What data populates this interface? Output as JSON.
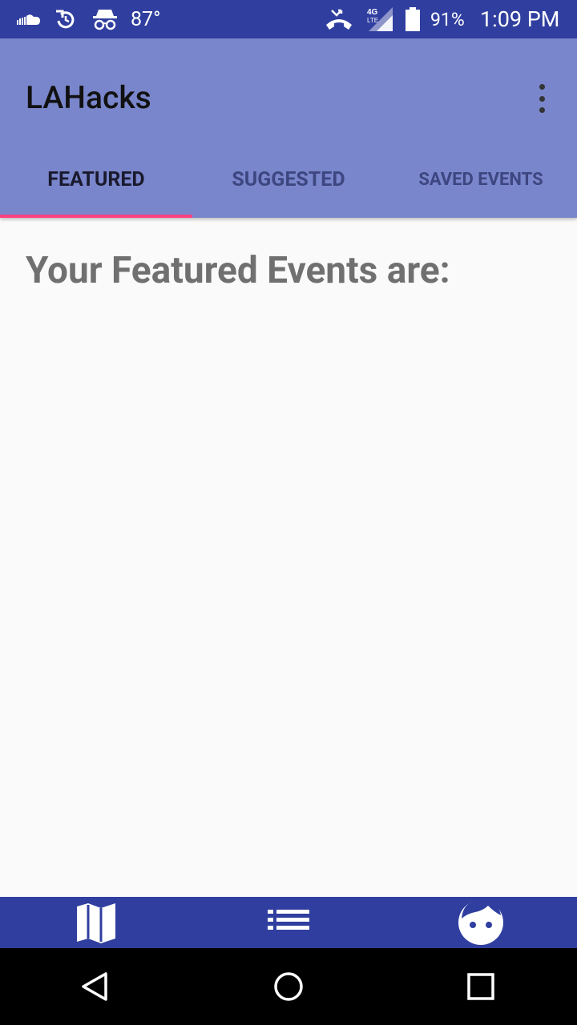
{
  "status_bar": {
    "temperature": "87°",
    "battery": "91%",
    "time": "1:09 PM",
    "network": "4G LTE",
    "icons": [
      "soundcloud-icon",
      "sync-icon",
      "incognito-icon",
      "missed-call-icon",
      "signal-icon",
      "battery-icon"
    ]
  },
  "app_bar": {
    "title": "LAHacks",
    "menu_icon": "more-vert-icon"
  },
  "tabs": [
    {
      "label": "FEATURED",
      "active": true
    },
    {
      "label": "SUGGESTED",
      "active": false
    },
    {
      "label": "SAVED EVENTS",
      "active": false
    }
  ],
  "main": {
    "heading": "Your Featured Events are:"
  },
  "bottom_nav": {
    "icons": [
      "map-icon",
      "list-icon",
      "face-icon"
    ]
  },
  "system_nav": {
    "icons": [
      "back-icon",
      "home-icon",
      "recents-icon"
    ]
  },
  "colors": {
    "status_bar": "#303f9f",
    "app_bar": "#7986cb",
    "tab_indicator": "#ff4081",
    "bottom_nav": "#303f9f"
  }
}
